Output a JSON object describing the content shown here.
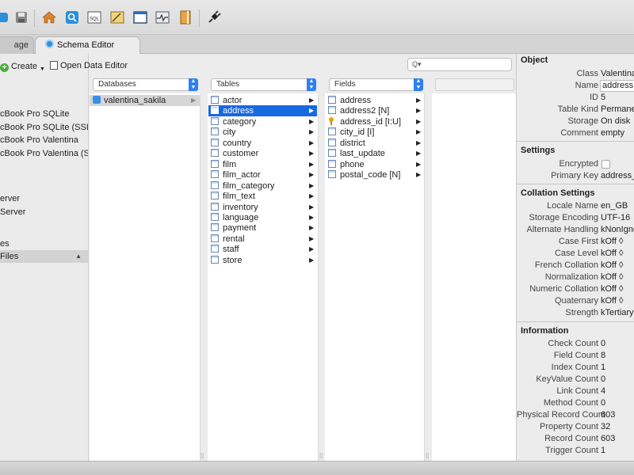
{
  "toolbar": {
    "icons": [
      "database-icon",
      "save-icon",
      "home-icon",
      "find-icon",
      "sql-icon",
      "report-icon",
      "layout-icon",
      "monitor-icon",
      "book-icon",
      "plugin-icon"
    ]
  },
  "tabs": [
    {
      "label": "age"
    },
    {
      "label": "Schema Editor"
    }
  ],
  "sidebar": {
    "create_label": "Create",
    "items": [
      {
        "label": "cBook Pro SQLite"
      },
      {
        "label": "cBook Pro SQLite (SSL)"
      },
      {
        "label": "cBook Pro Valentina"
      },
      {
        "label": "cBook Pro Valentina (S..."
      },
      {
        "label": "erver"
      },
      {
        "label": "Server"
      },
      {
        "label": "es"
      },
      {
        "label": "Files"
      }
    ]
  },
  "header": {
    "open_data_editor_label": "Open Data Editor",
    "search_placeholder": "Q▾",
    "databases_popup": "Databases",
    "tables_popup": "Tables",
    "fields_popup": "Fields"
  },
  "databases": [
    {
      "label": "valentina_sakila"
    }
  ],
  "tables": [
    {
      "label": "actor"
    },
    {
      "label": "address"
    },
    {
      "label": "category"
    },
    {
      "label": "city"
    },
    {
      "label": "country"
    },
    {
      "label": "customer"
    },
    {
      "label": "film"
    },
    {
      "label": "film_actor"
    },
    {
      "label": "film_category"
    },
    {
      "label": "film_text"
    },
    {
      "label": "inventory"
    },
    {
      "label": "language"
    },
    {
      "label": "payment"
    },
    {
      "label": "rental"
    },
    {
      "label": "staff"
    },
    {
      "label": "store"
    }
  ],
  "fields": [
    {
      "label": "address",
      "icon": "table"
    },
    {
      "label": "address2 [N]",
      "icon": "table"
    },
    {
      "label": "address_id [I:U]",
      "icon": "key"
    },
    {
      "label": "city_id [I]",
      "icon": "table"
    },
    {
      "label": "district",
      "icon": "table"
    },
    {
      "label": "last_update",
      "icon": "table"
    },
    {
      "label": "phone",
      "icon": "table"
    },
    {
      "label": "postal_code [N]",
      "icon": "table"
    }
  ],
  "panel": {
    "object": {
      "title": "Object",
      "rows": [
        {
          "label": "Class",
          "value": "Valentina T"
        },
        {
          "label": "Name",
          "value": "address"
        },
        {
          "label": "ID",
          "value": "5"
        },
        {
          "label": "Table Kind",
          "value": "Permanent"
        },
        {
          "label": "Storage",
          "value": "On disk"
        },
        {
          "label": "Comment",
          "value": "empty"
        }
      ]
    },
    "settings": {
      "title": "Settings",
      "rows": [
        {
          "label": "Encrypted",
          "value": ""
        },
        {
          "label": "Primary Key",
          "value": "address_id"
        }
      ]
    },
    "collation": {
      "title": "Collation Settings",
      "rows": [
        {
          "label": "Locale Name",
          "value": "en_GB"
        },
        {
          "label": "Storage Encoding",
          "value": "UTF-16"
        },
        {
          "label": "Alternate Handling",
          "value": "kNonIgnora"
        },
        {
          "label": "Case First",
          "value": "kOff ◊"
        },
        {
          "label": "Case Level",
          "value": "kOff ◊"
        },
        {
          "label": "French Collation",
          "value": "kOff ◊"
        },
        {
          "label": "Normalization",
          "value": "kOff ◊"
        },
        {
          "label": "Numeric Collation",
          "value": "kOff ◊"
        },
        {
          "label": "Quaternary",
          "value": "kOff ◊"
        },
        {
          "label": "Strength",
          "value": "kTertiary ◊"
        }
      ]
    },
    "information": {
      "title": "Information",
      "rows": [
        {
          "label": "Check Count",
          "value": "0"
        },
        {
          "label": "Field Count",
          "value": "8"
        },
        {
          "label": "Index Count",
          "value": "1"
        },
        {
          "label": "KeyValue Count",
          "value": "0"
        },
        {
          "label": "Link Count",
          "value": "4"
        },
        {
          "label": "Method Count",
          "value": "0"
        },
        {
          "label": "Physical Record Count",
          "value": "603"
        },
        {
          "label": "Property Count",
          "value": "32"
        },
        {
          "label": "Record Count",
          "value": "603"
        },
        {
          "label": "Trigger Count",
          "value": "1"
        }
      ]
    }
  },
  "colors": {
    "selection": "#1769e0",
    "accent_blue": "#2f7ff5"
  }
}
